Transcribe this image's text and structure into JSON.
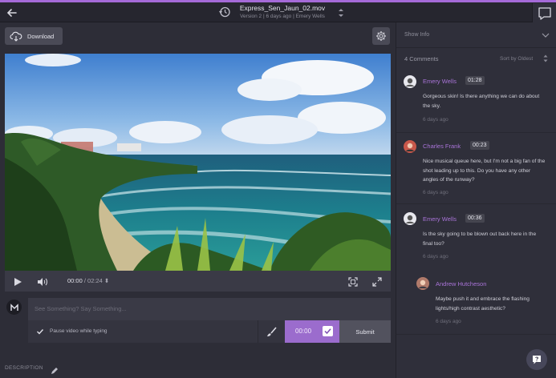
{
  "header": {
    "file_name": "Express_Sen_Jaun_02.mov",
    "file_meta": "Version 2  |  6 days ago  |  Emery Wells"
  },
  "toolbar": {
    "download_label": "Download"
  },
  "player": {
    "current_time": "00:00",
    "duration": "/ 02:24 ⬍"
  },
  "composer": {
    "placeholder": "See Something? Say Something...",
    "pause_label": "Pause video while typing",
    "timecode": "00:00",
    "submit_label": "Submit"
  },
  "description": {
    "label": "DESCRIPTION"
  },
  "sidebar": {
    "show_info": "Show Info",
    "comments_count": "4 Comments",
    "sort_label": "Sort by Oldest"
  },
  "comments": [
    {
      "name": "Emery Wells",
      "time": "01:28",
      "text": "Gorgeous skin! Is there anything we can do about the sky.",
      "ago": "6 days ago",
      "avatar_color": "#e8e8ee"
    },
    {
      "name": "Charles Frank",
      "time": "00:23",
      "text": "Nice musical queue here, but I'm not a big fan of the shot leading up to this. Do you have any other angles of the runway?",
      "ago": "6 days ago",
      "avatar_color": "#c8574a"
    },
    {
      "name": "Emery Wells",
      "time": "00:36",
      "text": "Is the sky going to be blown out back here in the final too?",
      "ago": "6 days ago",
      "avatar_color": "#e8e8ee"
    },
    {
      "name": "Andrew Hutcheson",
      "time": "",
      "text": "Maybe push it and embrace the flashing lights/high contrast aesthetic?",
      "ago": "6 days ago",
      "avatar_color": "#b07a6a"
    }
  ],
  "colors": {
    "accent": "#a56ad8",
    "timecode_box": "#9b6ccd"
  }
}
